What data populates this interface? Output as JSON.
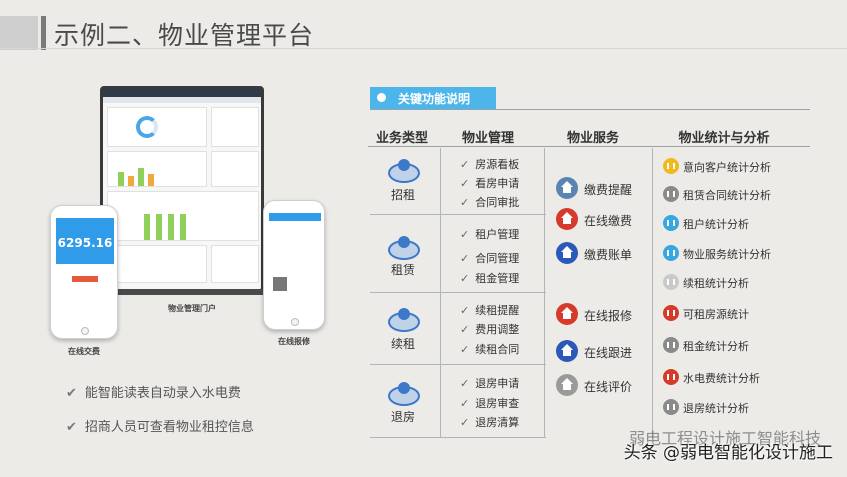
{
  "title": "示例二、物业管理平台",
  "devices": {
    "laptop_caption": "物业管理门户",
    "phone_left_caption": "在线交费",
    "phone_right_caption": "在线报修",
    "phone_left_amount": "6295.16"
  },
  "bullets": [
    "能智能读表自动录入水电费",
    "招商人员可查看物业租控信息"
  ],
  "key_section": "关键功能说明",
  "columns": [
    "业务类型",
    "物业管理",
    "物业服务",
    "物业统计与分析"
  ],
  "types": [
    "招租",
    "租赁",
    "续租",
    "退房"
  ],
  "mgmt": [
    [
      "房源看板",
      "看房申请",
      "合同审批"
    ],
    [
      "租户管理",
      "合同管理",
      "租金管理"
    ],
    [
      "续租提醒",
      "费用调整",
      "续租合同"
    ],
    [
      "退房申请",
      "退房审查",
      "退房清算"
    ]
  ],
  "services": [
    {
      "label": "缴费提醒",
      "color": "#5b84b1"
    },
    {
      "label": "在线缴费",
      "color": "#d63a2a"
    },
    {
      "label": "缴费账单",
      "color": "#2b59b8"
    },
    {
      "label": "在线报修",
      "color": "#d63a2a"
    },
    {
      "label": "在线跟进",
      "color": "#2b59b8"
    },
    {
      "label": "在线评价",
      "color": "#9a9a9a"
    }
  ],
  "stats": [
    {
      "label": "意向客户统计分析",
      "color": "#f0b91e"
    },
    {
      "label": "租赁合同统计分析",
      "color": "#8a8a8a"
    },
    {
      "label": "租户统计分析",
      "color": "#36a8e0"
    },
    {
      "label": "物业服务统计分析",
      "color": "#36a8e0"
    },
    {
      "label": "续租统计分析",
      "color": "#c9c9c9"
    },
    {
      "label": "可租房源统计",
      "color": "#d63a2a"
    },
    {
      "label": "租金统计分析",
      "color": "#8a8a8a"
    },
    {
      "label": "水电费统计分析",
      "color": "#d63a2a"
    },
    {
      "label": "退房统计分析",
      "color": "#8a8a8a"
    }
  ],
  "watermark_front": "头条 @弱电智能化设计施工",
  "watermark_back": "弱电工程设计施工智能科技"
}
